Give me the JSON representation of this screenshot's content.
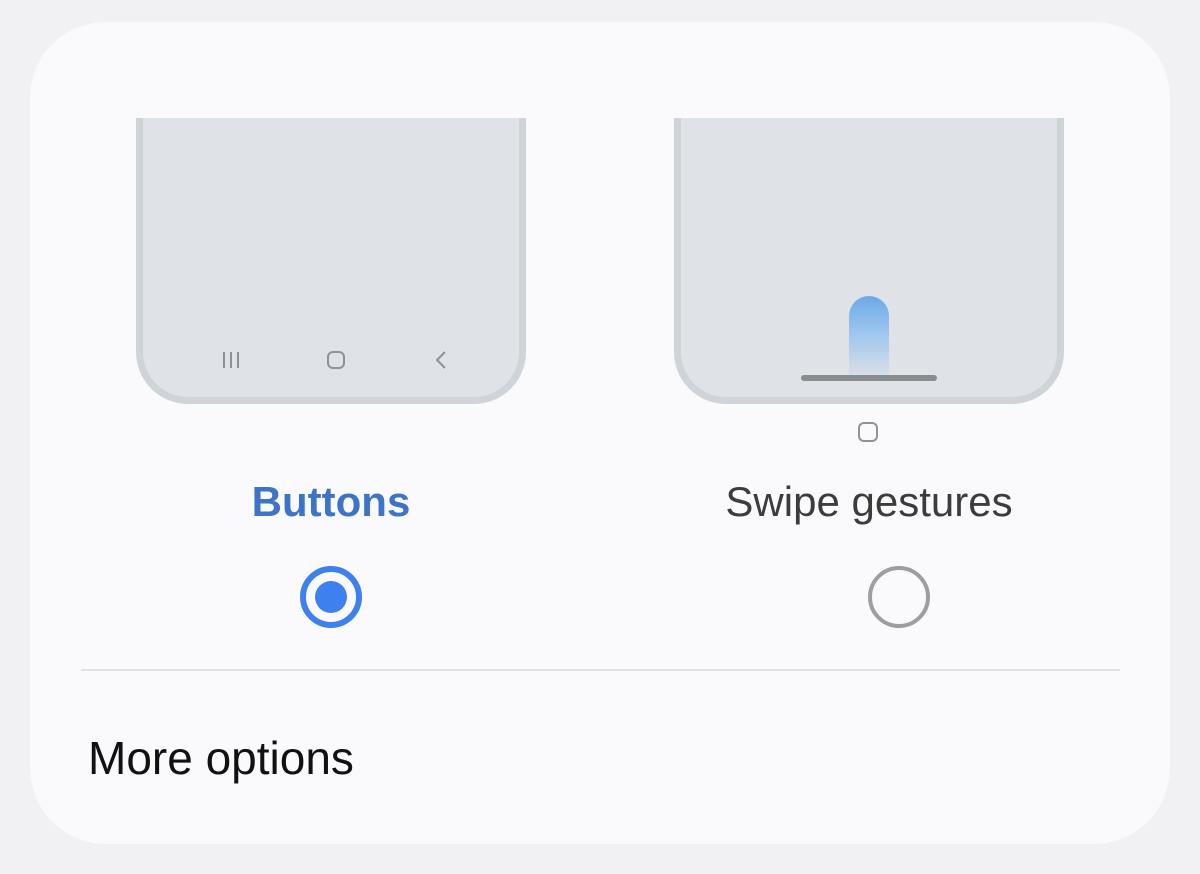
{
  "navigation_type": {
    "options": [
      {
        "label": "Buttons",
        "selected": true,
        "preview_icons": [
          "recents-icon",
          "home-icon",
          "back-icon"
        ]
      },
      {
        "label": "Swipe gestures",
        "selected": false,
        "preview_icons": [
          "swipe-up-gesture-icon",
          "home-hint-icon"
        ]
      }
    ]
  },
  "more_options": {
    "label": "More options"
  },
  "colors": {
    "accent": "#3e80ee",
    "selected_label": "#3e74c7",
    "card_background": "#fafafc",
    "page_background": "#f1f1f3"
  }
}
